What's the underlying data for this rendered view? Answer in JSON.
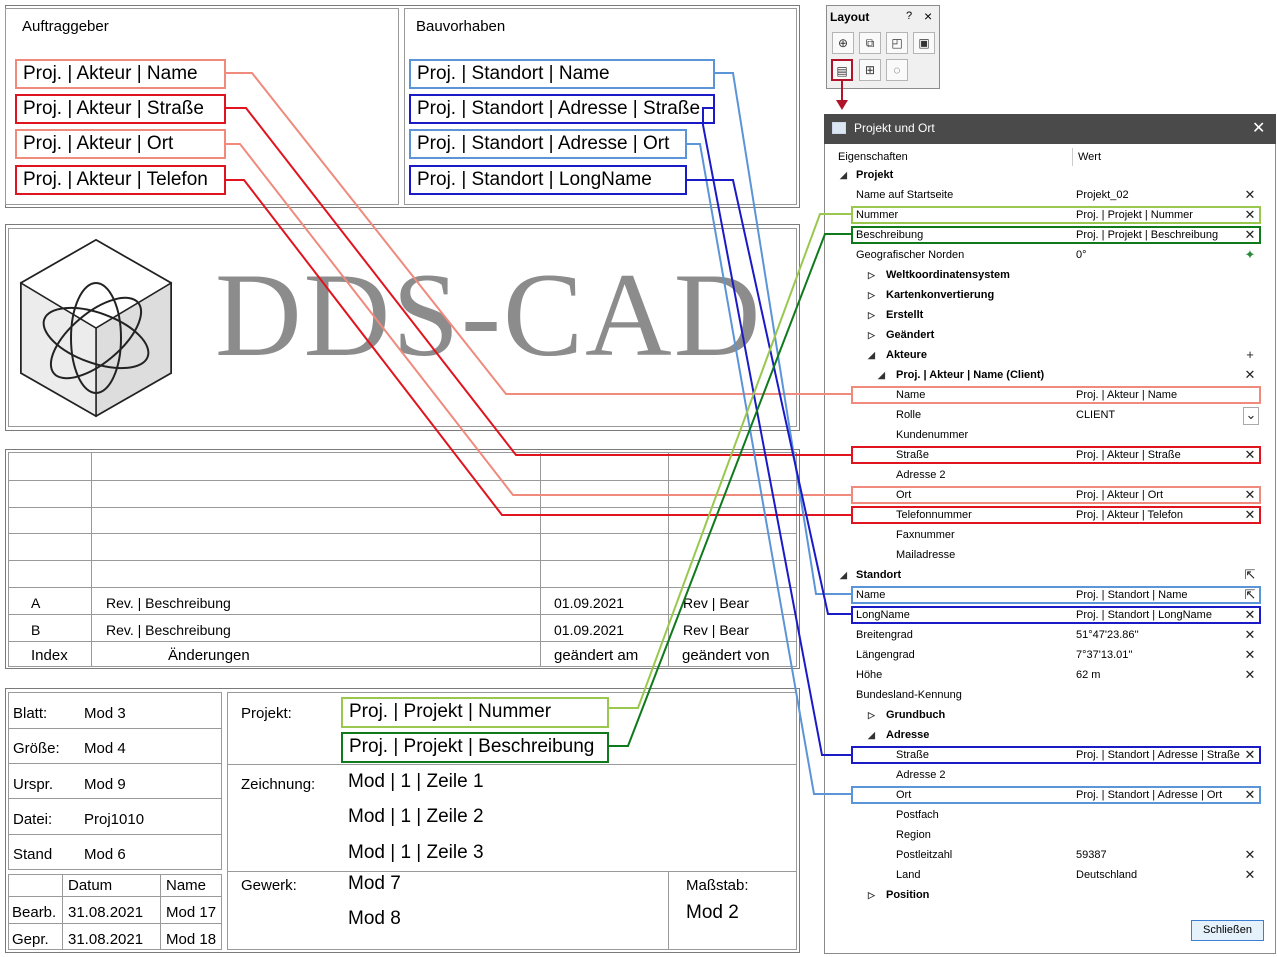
{
  "titleblock": {
    "auftraggeber_label": "Auftraggeber",
    "bauvorhaben_label": "Bauvorhaben",
    "client_fields": [
      "Proj. | Akteur | Name",
      "Proj. | Akteur | Straße",
      "Proj. | Akteur | Ort",
      "Proj. | Akteur | Telefon"
    ],
    "site_fields": [
      "Proj. | Standort | Name",
      "Proj. | Standort | Adresse | Straße",
      "Proj. | Standort | Adresse | Ort",
      "Proj. | Standort | LongName"
    ],
    "logo_text": "DDS-CAD",
    "revisions": {
      "rows": [
        {
          "index": "A",
          "desc": "Rev. | Beschreibung",
          "date": "01.09.2021",
          "by": "Rev | Bear"
        },
        {
          "index": "B",
          "desc": "Rev. | Beschreibung",
          "date": "01.09.2021",
          "by": "Rev | Bear"
        }
      ],
      "header": {
        "index": "Index",
        "desc": "Änderungen",
        "date": "geändert am",
        "by": "geändert von"
      }
    },
    "info": {
      "blatt_label": "Blatt:",
      "blatt": "Mod 3",
      "groesse_label": "Größe:",
      "groesse": "Mod 4",
      "urspr_label": "Urspr.",
      "urspr": "Mod 9",
      "datei_label": "Datei:",
      "datei": "Proj1010",
      "stand_label": "Stand",
      "stand": "Mod 6"
    },
    "dates": {
      "col_datum": "Datum",
      "col_name": "Name",
      "bearb_label": "Bearb.",
      "bearb_date": "31.08.2021",
      "bearb_name": "Mod 17",
      "gepr_label": "Gepr.",
      "gepr_date": "31.08.2021",
      "gepr_name": "Mod 18"
    },
    "projekt_label": "Projekt:",
    "projekt_nummer": "Proj. | Projekt | Nummer",
    "projekt_beschreibung": "Proj. | Projekt | Beschreibung",
    "zeichnung_label": "Zeichnung:",
    "zeichnung_lines": [
      "Mod | 1 | Zeile 1",
      "Mod | 1 | Zeile 2",
      "Mod | 1 | Zeile 3"
    ],
    "gewerk_label": "Gewerk:",
    "gewerk_lines": [
      "Mod 7",
      "Mod 8"
    ],
    "massstab_label": "Maßstab:",
    "massstab": "Mod 2"
  },
  "layout_toolbar": {
    "title": "Layout",
    "help": "?",
    "close": "×"
  },
  "dialog": {
    "title": "Projekt und Ort",
    "close": "✕",
    "col_props": "Eigenschaften",
    "col_value": "Wert",
    "rows": [
      {
        "k": "Projekt",
        "v": "",
        "bold": true,
        "tri": "◢"
      },
      {
        "k": "Name auf Startseite",
        "v": "Projekt_02",
        "x": "✕"
      },
      {
        "k": "Nummer",
        "v": "Proj. | Projekt | Nummer",
        "x": "✕"
      },
      {
        "k": "Beschreibung",
        "v": "Proj. | Projekt | Beschreibung",
        "x": "✕"
      },
      {
        "k": "Geografischer Norden",
        "v": "0°",
        "x": "✦"
      },
      {
        "k": "Weltkoordinatensystem",
        "v": "",
        "bold": true,
        "tri": "▷"
      },
      {
        "k": "Kartenkonvertierung",
        "v": "",
        "bold": true,
        "tri": "▷"
      },
      {
        "k": "Erstellt",
        "v": "",
        "bold": true,
        "tri": "▷"
      },
      {
        "k": "Geändert",
        "v": "",
        "bold": true,
        "tri": "▷"
      },
      {
        "k": "Akteure",
        "v": "",
        "bold": true,
        "tri": "◢",
        "x": "+"
      },
      {
        "k": "Proj. | Akteur | Name (Client)",
        "v": "",
        "bold": true,
        "tri": "◢",
        "x": "✕"
      },
      {
        "k": "Name",
        "v": "Proj. | Akteur | Name",
        "x": ""
      },
      {
        "k": "Rolle",
        "v": "CLIENT",
        "x": "⌄"
      },
      {
        "k": "Kundenummer",
        "v": ""
      },
      {
        "k": "Straße",
        "v": "Proj. | Akteur | Straße",
        "x": "✕"
      },
      {
        "k": "Adresse 2",
        "v": ""
      },
      {
        "k": "Ort",
        "v": "Proj. | Akteur | Ort",
        "x": "✕"
      },
      {
        "k": "Telefonnummer",
        "v": "Proj. | Akteur | Telefon",
        "x": "✕"
      },
      {
        "k": "Faxnummer",
        "v": ""
      },
      {
        "k": "Mailadresse",
        "v": ""
      },
      {
        "k": "Standort",
        "v": "",
        "bold": true,
        "tri": "◢",
        "x": "⇱"
      },
      {
        "k": "Name",
        "v": "Proj. | Standort | Name",
        "x": "⇱"
      },
      {
        "k": "LongName",
        "v": "Proj. | Standort | LongName",
        "x": "✕"
      },
      {
        "k": "Breitengrad",
        "v": "51°47'23.86''",
        "x": "✕"
      },
      {
        "k": "Längengrad",
        "v": "7°37'13.01''",
        "x": "✕"
      },
      {
        "k": "Höhe",
        "v": "62 m",
        "x": "✕"
      },
      {
        "k": "Bundesland-Kennung",
        "v": ""
      },
      {
        "k": "Grundbuch",
        "v": "",
        "bold": true,
        "tri": "▷"
      },
      {
        "k": "Adresse",
        "v": "",
        "bold": true,
        "tri": "◢"
      },
      {
        "k": "Straße",
        "v": "Proj. | Standort | Adresse | Straße",
        "x": "✕"
      },
      {
        "k": "Adresse 2",
        "v": ""
      },
      {
        "k": "Ort",
        "v": "Proj. | Standort | Adresse | Ort",
        "x": "✕"
      },
      {
        "k": "Postfach",
        "v": ""
      },
      {
        "k": "Region",
        "v": ""
      },
      {
        "k": "Postleitzahl",
        "v": "59387",
        "x": "✕"
      },
      {
        "k": "Land",
        "v": "Deutschland",
        "x": "✕"
      },
      {
        "k": "Position",
        "v": "",
        "bold": true,
        "tri": "▷"
      }
    ],
    "close_button": "Schließen"
  },
  "colors": {
    "light_red": "#ef8a7c",
    "red": "#e0141e",
    "light_blue": "#5b95d8",
    "blue": "#1a1ac7",
    "light_green": "#9ac84e",
    "green": "#0f7a1c",
    "dark_red_arrow": "#b0142a"
  }
}
